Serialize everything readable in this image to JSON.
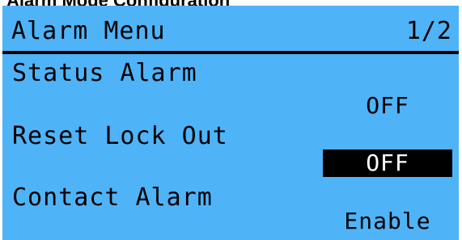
{
  "page": {
    "caption": "Alarm Mode Configuration"
  },
  "screen": {
    "title": "Alarm Menu",
    "page_indicator": "1/2",
    "items": [
      {
        "label": "Status Alarm",
        "value": "OFF",
        "selected": false
      },
      {
        "label": "Reset Lock Out",
        "value": "OFF",
        "selected": true
      },
      {
        "label": "Contact Alarm",
        "value": "Enable",
        "selected": false
      }
    ]
  },
  "colors": {
    "screen_background": "#4fb3f8",
    "foreground": "#000000",
    "selection_background": "#000000",
    "selection_text": "#ffffff"
  }
}
